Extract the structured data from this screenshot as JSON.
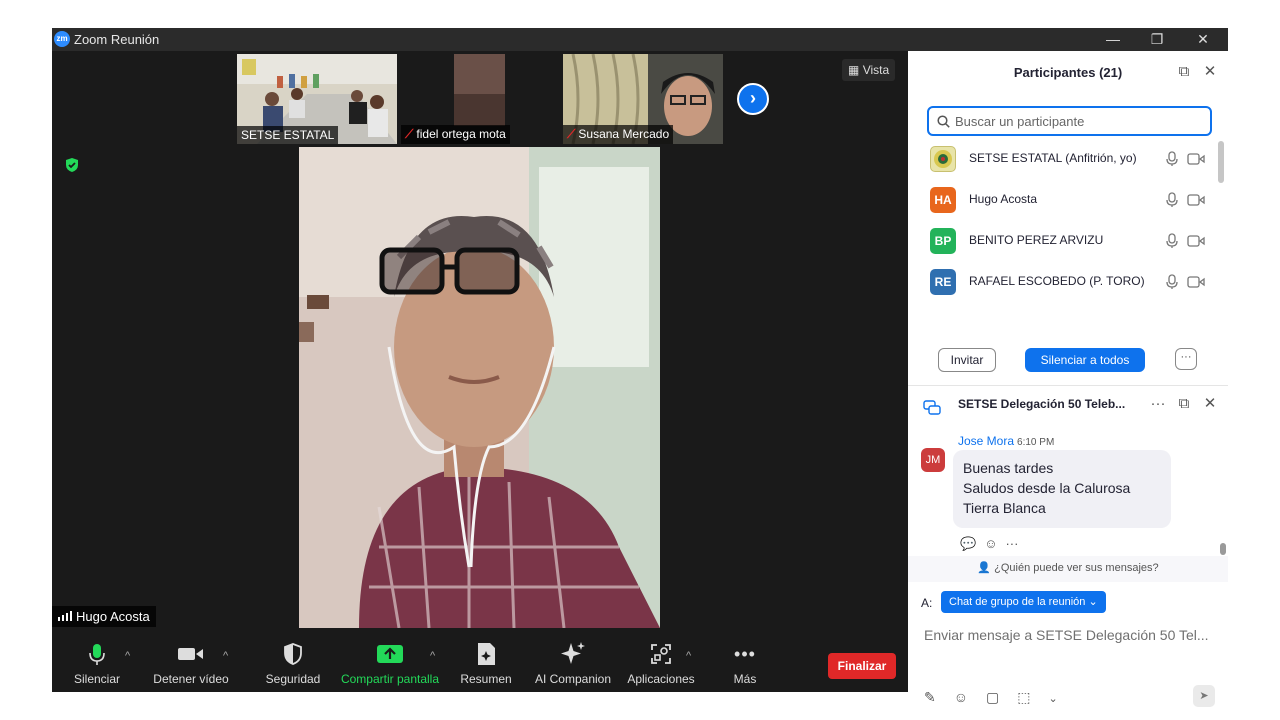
{
  "window": {
    "title": "Zoom Reunión",
    "logo": "zm",
    "controls": {
      "minimize": "—",
      "restore": "❐",
      "close": "✕"
    }
  },
  "stage": {
    "view_label": "Vista",
    "thumbnails": [
      {
        "name": "SETSE ESTATAL",
        "muted": false
      },
      {
        "name": "fidel ortega mota",
        "muted": true
      },
      {
        "name": "Susana Mercado",
        "muted": true
      }
    ],
    "next_icon": "chevron-right-icon",
    "speaker_name": "Hugo Acosta"
  },
  "toolbar": {
    "mute": "Silenciar",
    "stop_video": "Detener vídeo",
    "security": "Seguridad",
    "share": "Compartir pantalla",
    "summary": "Resumen",
    "ai": "AI Companion",
    "apps": "Aplicaciones",
    "more": "Más",
    "end": "Finalizar"
  },
  "participants": {
    "title": "Participantes (21)",
    "search_placeholder": "Buscar un participante",
    "list": [
      {
        "initials": "",
        "name": "SETSE ESTATAL (Anfitrión, yo)",
        "color": "#e8e4a8"
      },
      {
        "initials": "HA",
        "name": "Hugo Acosta",
        "color": "#e8661c"
      },
      {
        "initials": "BP",
        "name": "BENITO PEREZ ARVIZU",
        "color": "#23b35a"
      },
      {
        "initials": "RE",
        "name": "RAFAEL ESCOBEDO (P. TORO)",
        "color": "#2f6fb0"
      }
    ],
    "invite": "Invitar",
    "mute_all": "Silenciar a todos",
    "more": "···"
  },
  "chat": {
    "title": "SETSE Delegación 50 Teleb...",
    "more": "···",
    "message": {
      "sender": "Jose Mora",
      "time": "6:10 PM",
      "initials": "JM",
      "lines": [
        "Buenas tardes",
        "Saludos desde la Calurosa",
        "Tierra Blanca"
      ]
    },
    "actions_more": "···",
    "who_can_see": "¿Quién puede ver sus mensajes?",
    "to_label": "A:",
    "to_value": "Chat de grupo de la reunión",
    "input_placeholder": "Enviar mensaje a SETSE Delegación 50 Tel..."
  },
  "colors": {
    "accent": "#0e72ed",
    "end_red": "#e02828",
    "share_green": "#23d959",
    "stage_bg": "#1a1a1a"
  }
}
